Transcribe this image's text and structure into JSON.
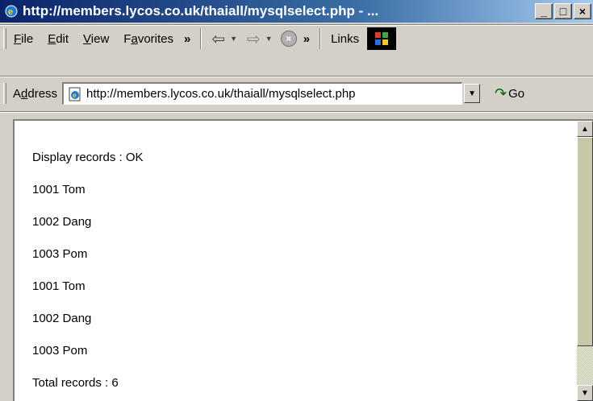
{
  "window": {
    "title": "http://members.lycos.co.uk/thaiall/mysqlselect.php - ...",
    "minimize_glyph": "_",
    "maximize_glyph": "□",
    "close_glyph": "×"
  },
  "menu": {
    "items": [
      {
        "label": "File",
        "accel": "F",
        "rest": "ile"
      },
      {
        "label": "Edit",
        "accel": "E",
        "rest": "dit"
      },
      {
        "label": "View",
        "accel": "V",
        "rest": "iew"
      },
      {
        "label": "Favorites",
        "accel": "a",
        "pre": "F",
        "rest": "vorites"
      }
    ],
    "chevron": "»",
    "links_label": "Links"
  },
  "address": {
    "label": "Address",
    "url": "http://members.lycos.co.uk/thaiall/mysqlselect.php",
    "go_label": "Go"
  },
  "content": {
    "lines": [
      "Display records : OK",
      "1001 Tom",
      "1002 Dang",
      "1003 Pom",
      "1001 Tom",
      "1002 Dang",
      "1003 Pom",
      "Total records : 6"
    ]
  },
  "icons": {
    "ie_logo": "ie-logo-icon",
    "back": "back-arrow-icon",
    "forward": "forward-arrow-icon",
    "stop": "stop-icon",
    "go": "go-arrow-icon",
    "windows_logo": "windows-logo-icon"
  },
  "colors": {
    "titlebar_start": "#0a246a",
    "titlebar_end": "#a6caf0",
    "chrome": "#d4d0c8"
  }
}
